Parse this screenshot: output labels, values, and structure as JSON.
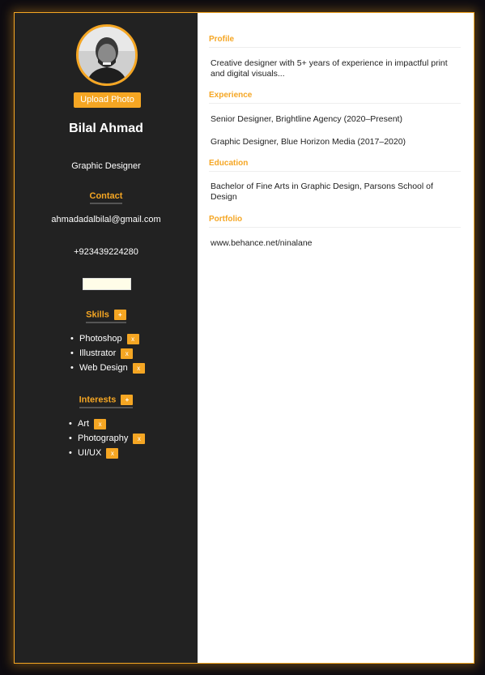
{
  "sidebar": {
    "upload_label": "Upload Photo",
    "name": "Bilal Ahmad",
    "title": "Graphic Designer",
    "contact_heading": "Contact",
    "email": "ahmadadalbilal@gmail.com",
    "phone": "+923439224280",
    "skills_heading": "Skills",
    "skills": [
      "Photoshop",
      "Illustrator",
      "Web Design"
    ],
    "interests_heading": "Interests",
    "interests": [
      "Art",
      "Photography",
      "UI/UX"
    ],
    "add_label": "+",
    "remove_label": "x",
    "bullet": "•"
  },
  "main": {
    "profile_heading": "Profile",
    "profile_text": "Creative designer with 5+ years of experience in impactful print and digital visuals...",
    "experience_heading": "Experience",
    "experience": [
      "Senior Designer, Brightline Agency (2020–Present)",
      "Graphic Designer, Blue Horizon Media (2017–2020)"
    ],
    "education_heading": "Education",
    "education_text": "Bachelor of Fine Arts in Graphic Design, Parsons School of Design",
    "portfolio_heading": "Portfolio",
    "portfolio_text": "www.behance.net/ninalane"
  },
  "colors": {
    "accent": "#f5a623",
    "sidebar_bg": "#222222",
    "page_bg": "#0d0b10"
  }
}
